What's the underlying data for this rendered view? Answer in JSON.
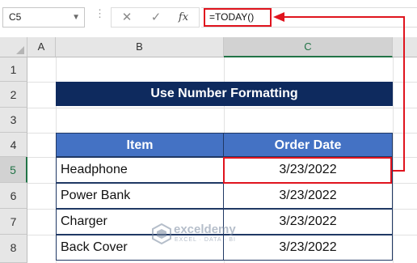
{
  "formula_bar": {
    "name_box": "C5",
    "formula": "=TODAY()",
    "fx_label": "fx",
    "cancel_glyph": "✕",
    "enter_glyph": "✓"
  },
  "columns": [
    "A",
    "B",
    "C"
  ],
  "rows": [
    "1",
    "2",
    "3",
    "4",
    "5",
    "6",
    "7",
    "8"
  ],
  "title": "Use Number Formatting",
  "table": {
    "headers": [
      "Item",
      "Order Date"
    ],
    "rows": [
      {
        "item": "Headphone",
        "date": "3/23/2022"
      },
      {
        "item": "Power Bank",
        "date": "3/23/2022"
      },
      {
        "item": "Charger",
        "date": "3/23/2022"
      },
      {
        "item": "Back Cover",
        "date": "3/23/2022"
      }
    ]
  },
  "watermark": {
    "name": "exceldemy",
    "tagline": "EXCEL · DATA · BI"
  },
  "colors": {
    "accent_red": "#e0141e",
    "header_blue": "#4472c4",
    "title_navy": "#0e2a5e",
    "excel_green": "#217346"
  },
  "icons": {
    "namebox_dropdown": "chevron-down-icon",
    "watermark_logo": "exceldemy-logo-icon"
  }
}
